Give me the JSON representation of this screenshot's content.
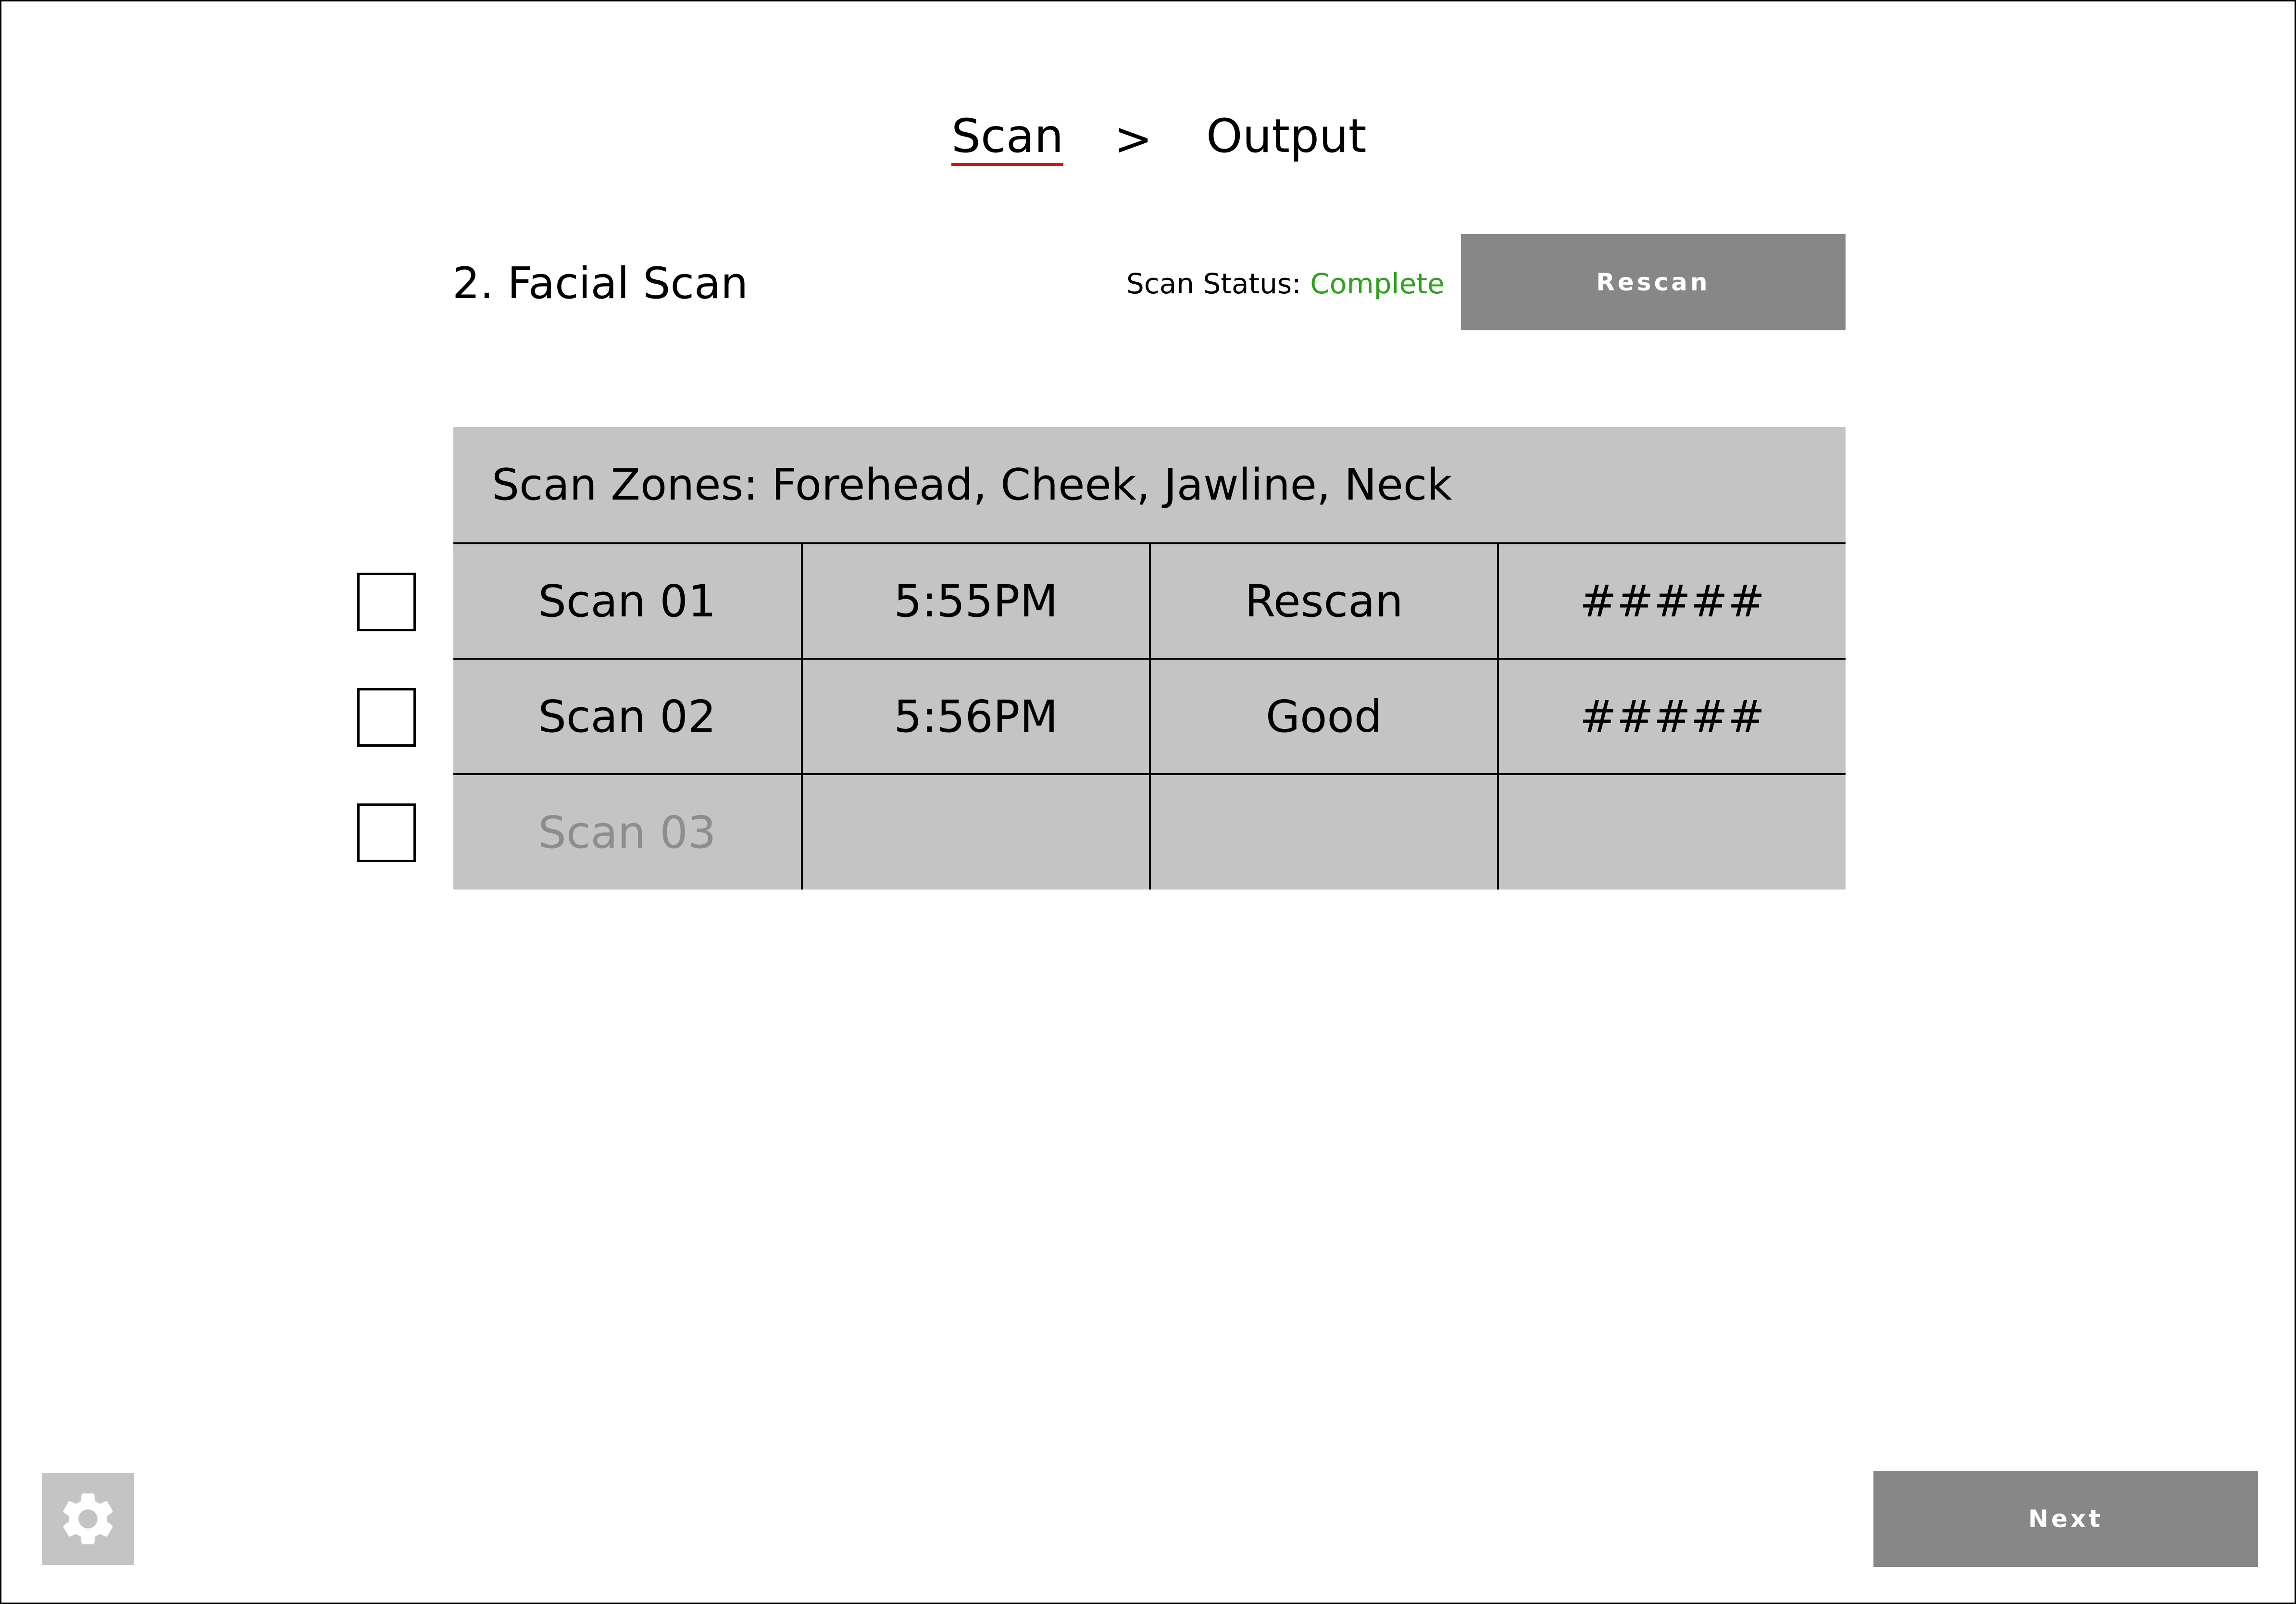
{
  "breadcrumb": {
    "steps": [
      "Scan",
      "Output"
    ],
    "separator": ">",
    "active_index": 0
  },
  "section": {
    "title": "2. Facial Scan",
    "status_label": "Scan Status:",
    "status_value": "Complete",
    "rescan_label": "Rescan"
  },
  "table": {
    "zones_label": "Scan Zones: Forehead, Cheek, Jawline, Neck",
    "rows": [
      {
        "name": "Scan 01",
        "time": "5:55PM",
        "result": "Rescan",
        "value": "#####",
        "checked": false
      },
      {
        "name": "Scan 02",
        "time": "5:56PM",
        "result": "Good",
        "value": "#####",
        "checked": false
      },
      {
        "name": "Scan 03",
        "time": "",
        "result": "",
        "value": "",
        "checked": false
      }
    ]
  },
  "footer": {
    "next_label": "Next",
    "settings_icon": "gear-icon"
  },
  "colors": {
    "accent_underline": "#d4161c",
    "status_complete": "#2ea11f",
    "button_bg": "#878787",
    "table_bg": "#c4c4c4",
    "muted_text": "#8d8d8d"
  }
}
